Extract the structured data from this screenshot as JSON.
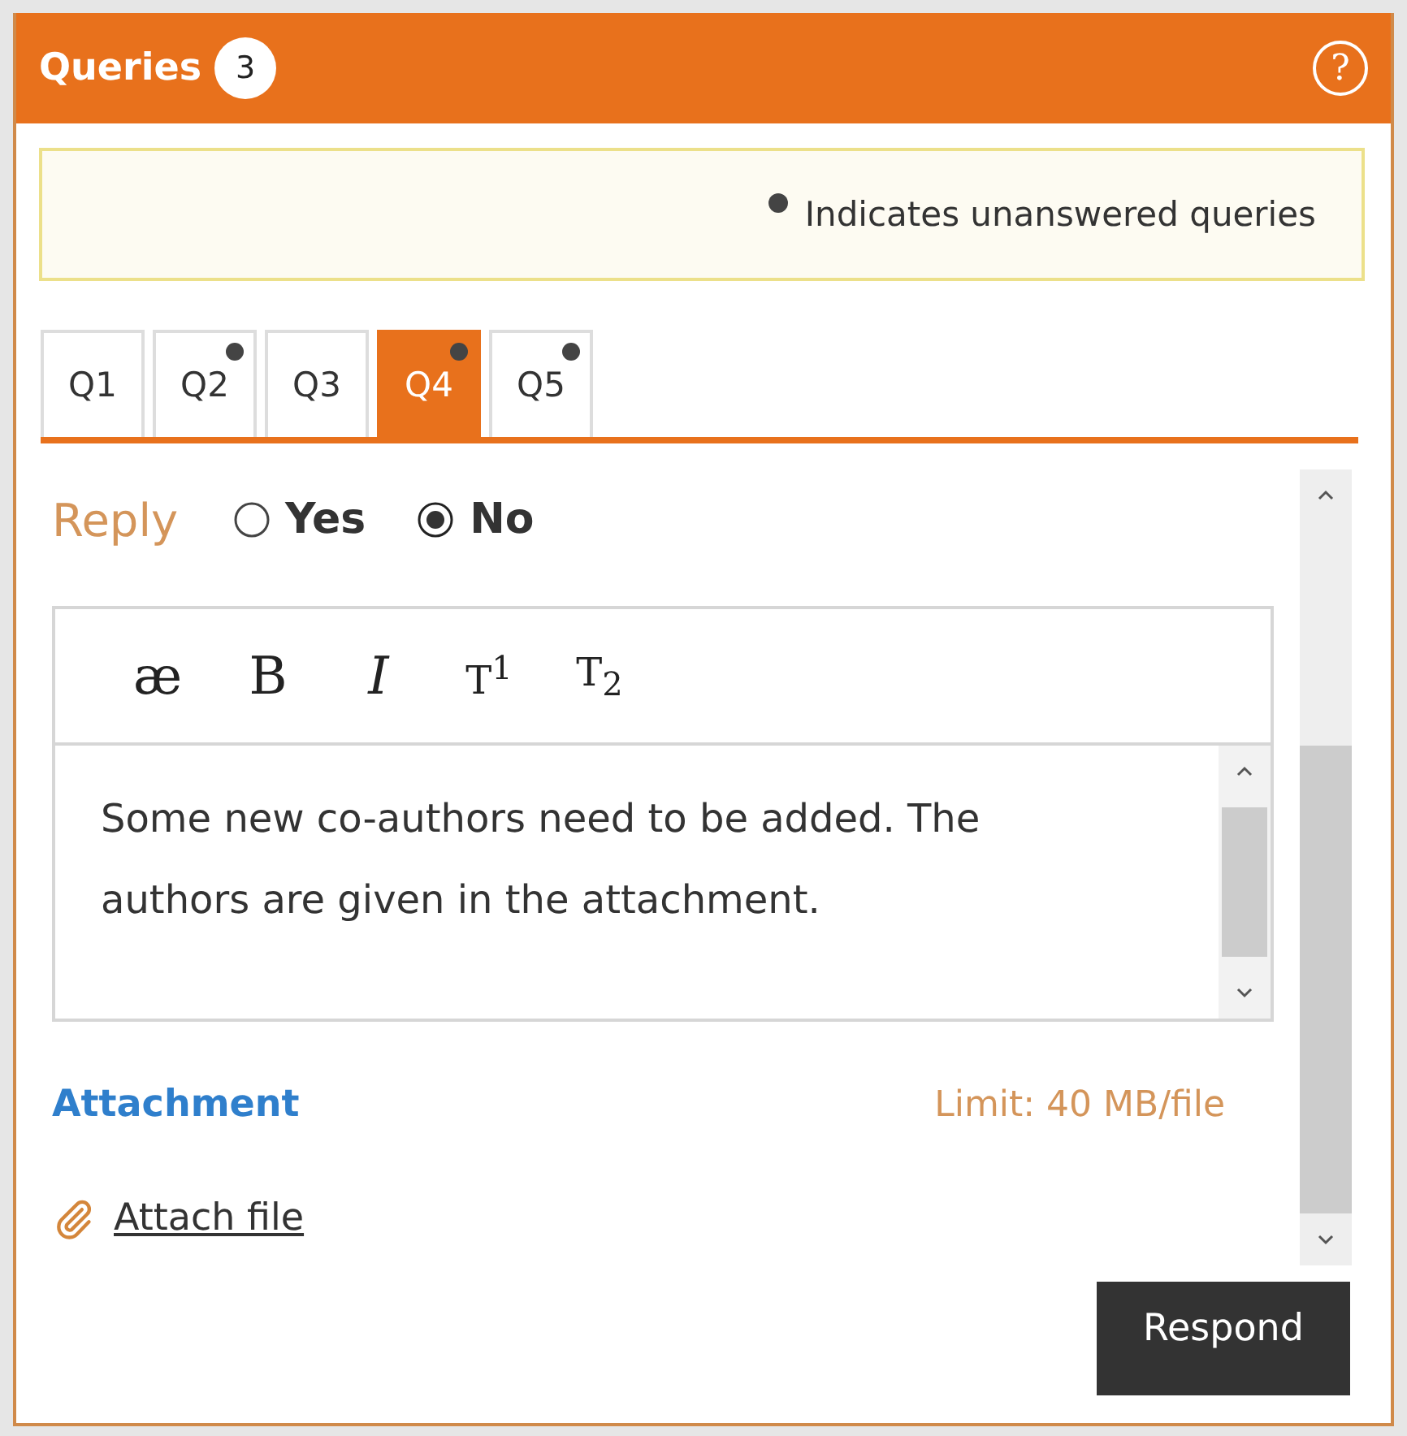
{
  "header": {
    "title": "Queries",
    "count": "3",
    "help": "?"
  },
  "legend": {
    "text": "Indicates unanswered queries"
  },
  "tabs": [
    {
      "label": "Q1",
      "selected": false,
      "unanswered": false
    },
    {
      "label": "Q2",
      "selected": false,
      "unanswered": true
    },
    {
      "label": "Q3",
      "selected": false,
      "unanswered": false
    },
    {
      "label": "Q4",
      "selected": true,
      "unanswered": true
    },
    {
      "label": "Q5",
      "selected": false,
      "unanswered": true
    }
  ],
  "reply": {
    "label": "Reply",
    "options": [
      {
        "label": "Yes",
        "selected": false
      },
      {
        "label": "No",
        "selected": true
      }
    ]
  },
  "toolbar": [
    {
      "kind": "special",
      "label": "æ"
    },
    {
      "kind": "bold",
      "label": "B"
    },
    {
      "kind": "italic",
      "label": "I"
    },
    {
      "kind": "superscript",
      "label": "T$^{1}$"
    },
    {
      "kind": "subscript",
      "label": "T$_{2}$"
    }
  ],
  "editor": {
    "value": "Some new co-authors need to be added. The authors are given in the attachment."
  },
  "attachment": {
    "label": "Attachment",
    "limit": "Limit: 40 MB/file",
    "link": "Attach file"
  },
  "respond_button": "Respond"
}
